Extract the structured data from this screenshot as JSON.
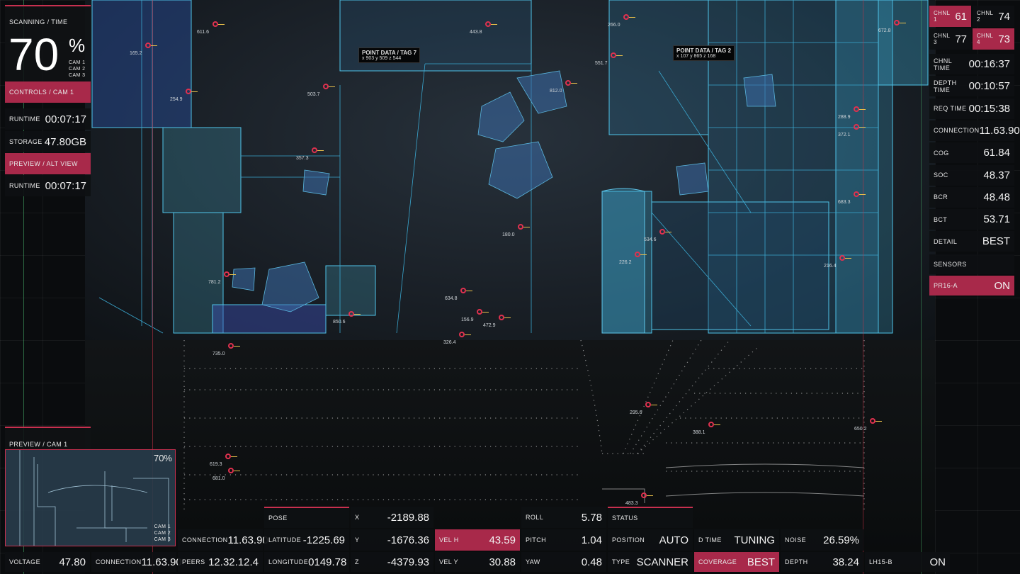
{
  "left_panel": {
    "scan_title": "SCANNING / TIME",
    "scan_percent": "70",
    "percent_sign": "%",
    "cams": [
      "CAM 1",
      "CAM 2",
      "CAM 3"
    ],
    "controls_title": "CONTROLS / CAM 1",
    "runtime_label": "RUNTIME",
    "runtime_value": "00:07:17",
    "storage_label": "STORAGE",
    "storage_value": "47.80GB",
    "preview_alt_title": "PREVIEW / ALT VIEW",
    "runtime2_label": "RUNTIME",
    "runtime2_value": "00:07:17",
    "preview_cam_title": "PREVIEW / CAM 1",
    "preview_percent": "70%",
    "preview_cams": [
      "CAM 1",
      "CAM 2",
      "CAM 3"
    ]
  },
  "right_panel": {
    "channels": [
      {
        "label": "CHNL 1",
        "value": "61",
        "active": true
      },
      {
        "label": "CHNL 2",
        "value": "74",
        "active": false
      },
      {
        "label": "CHNL 3",
        "value": "77",
        "active": false
      },
      {
        "label": "CHNL 4",
        "value": "73",
        "active": true
      }
    ],
    "rows": [
      {
        "label": "CHNL TIME",
        "value": "00:16:37"
      },
      {
        "label": "DEPTH TIME",
        "value": "00:10:57"
      },
      {
        "label": "REQ TIME",
        "value": "00:15:38"
      },
      {
        "label": "CONNECTION",
        "value": "11.63.90"
      },
      {
        "label": "COG",
        "value": "61.84"
      },
      {
        "label": "SOC",
        "value": "48.37"
      },
      {
        "label": "BCR",
        "value": "48.48"
      },
      {
        "label": "BCT",
        "value": "53.71"
      },
      {
        "label": "DETAIL",
        "value": "BEST"
      }
    ],
    "sensors_title": "SENSORS",
    "sensor_label": "PR16-A",
    "sensor_value": "ON"
  },
  "bottom_bar": {
    "voltage_label": "VOLTAGE",
    "voltage_value": "47.80",
    "connection_label": "CONNECTION",
    "connection_value": "11.63.90",
    "connection2_label": "CONNECTION",
    "connection2_value": "11.63.90",
    "peers_label": "PEERS",
    "peers_value": "12.32.12.4",
    "pose_title": "POSE",
    "latitude_label": "LATITUDE",
    "latitude_value": "-1225.69",
    "longitude_label": "LONGITUDE",
    "longitude_value": "0149.78",
    "x_label": "X",
    "x_value": "-2189.88",
    "y_label": "Y",
    "y_value": "-1676.36",
    "z_label": "Z",
    "z_value": "-4379.93",
    "velh_label": "VEL H",
    "velh_value": "43.59",
    "vely_label": "VEL Y",
    "vely_value": "30.88",
    "roll_label": "ROLL",
    "roll_value": "5.78",
    "pitch_label": "PITCH",
    "pitch_value": "1.04",
    "yaw_label": "YAW",
    "yaw_value": "0.48",
    "status_title": "STATUS",
    "position_label": "POSITION",
    "position_value": "AUTO",
    "type_label": "TYPE",
    "type_value": "SCANNER",
    "dtime_label": "D TIME",
    "dtime_value": "TUNING",
    "coverage_label": "COVERAGE",
    "coverage_value": "BEST",
    "noise_label": "NOISE",
    "noise_value": "26.59%",
    "depth_label": "DEPTH",
    "depth_value": "38.24",
    "lh_label": "LH15-B",
    "lh_value": "ON"
  },
  "tags": [
    {
      "title": "POINT DATA / TAG 7",
      "coords": "x 903   y 509   z 544"
    },
    {
      "title": "POINT DATA / TAG 2",
      "coords": "x 107   y 865   z 168"
    }
  ],
  "markers": [
    "503.7",
    "357.3",
    "812.0",
    "551.7",
    "180.0",
    "634.8",
    "156.9",
    "472.9",
    "850.6",
    "326.4",
    "226.2",
    "534.6",
    "735.0",
    "781.2",
    "619.3",
    "681.0",
    "295.6",
    "388.1",
    "650.2",
    "483.3",
    "266.0",
    "443.8",
    "611.6",
    "165.2",
    "254.9",
    "672.8",
    "288.9",
    "372.1",
    "683.3",
    "216.4"
  ]
}
